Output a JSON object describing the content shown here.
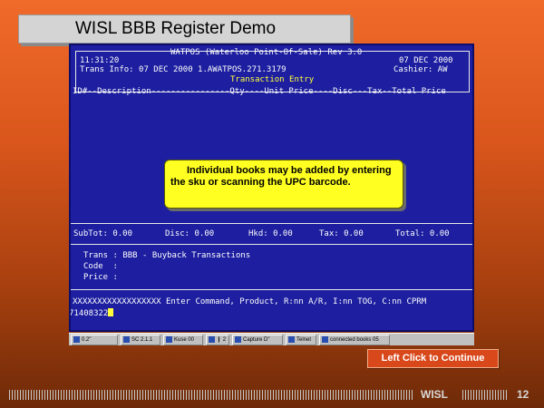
{
  "slide": {
    "title": "WISL BBB Register Demo",
    "continue_label": "Left Click to Continue",
    "footer_brand": "WISL",
    "page_number": "12"
  },
  "terminal": {
    "header_time": "11:31:20",
    "header_app": "WATPOS (Waterloo Point-Of-Sale) Rev 3.0",
    "header_date": "07 DEC 2000",
    "trans_info": "Trans Info: 07 DEC 2000 1.AWATPOS.271.3179",
    "cashier": "Cashier: AW",
    "section_title": "Transaction Entry",
    "column_header": "ID#--Description----------------Qty----Unit Price----Disc---Tax--Total Price",
    "totals": {
      "subtot": "SubTot: 0.00",
      "disc": "Disc: 0.00",
      "hkd": "Hkd: 0.00",
      "tax": "Tax: 0.00",
      "total": "Total: 0.00"
    },
    "trans_line": "Trans : BBB - Buyback Transactions",
    "code_line": "Code  :",
    "price_line": "Price :",
    "command_prompt": "XXXXXXXXXXXXXXXXXX Enter Command, Product, R:nn A/R, I:nn TOG, C:nn CPRM",
    "input_value": "71408322"
  },
  "callout": {
    "text": "Individual books may be added by entering the sku or scanning the UPC barcode."
  },
  "taskbar": {
    "items": [
      "0.2\"",
      "SC 2.1.1",
      "Kuse 00",
      "❙ 2",
      "Capture D\"",
      "Telnet",
      "connected books 05"
    ]
  },
  "colors": {
    "terminal_bg": "#1d1fa0",
    "highlight": "#ffff3c",
    "callout_bg": "#ffff22",
    "button_bg": "#d8481a"
  }
}
